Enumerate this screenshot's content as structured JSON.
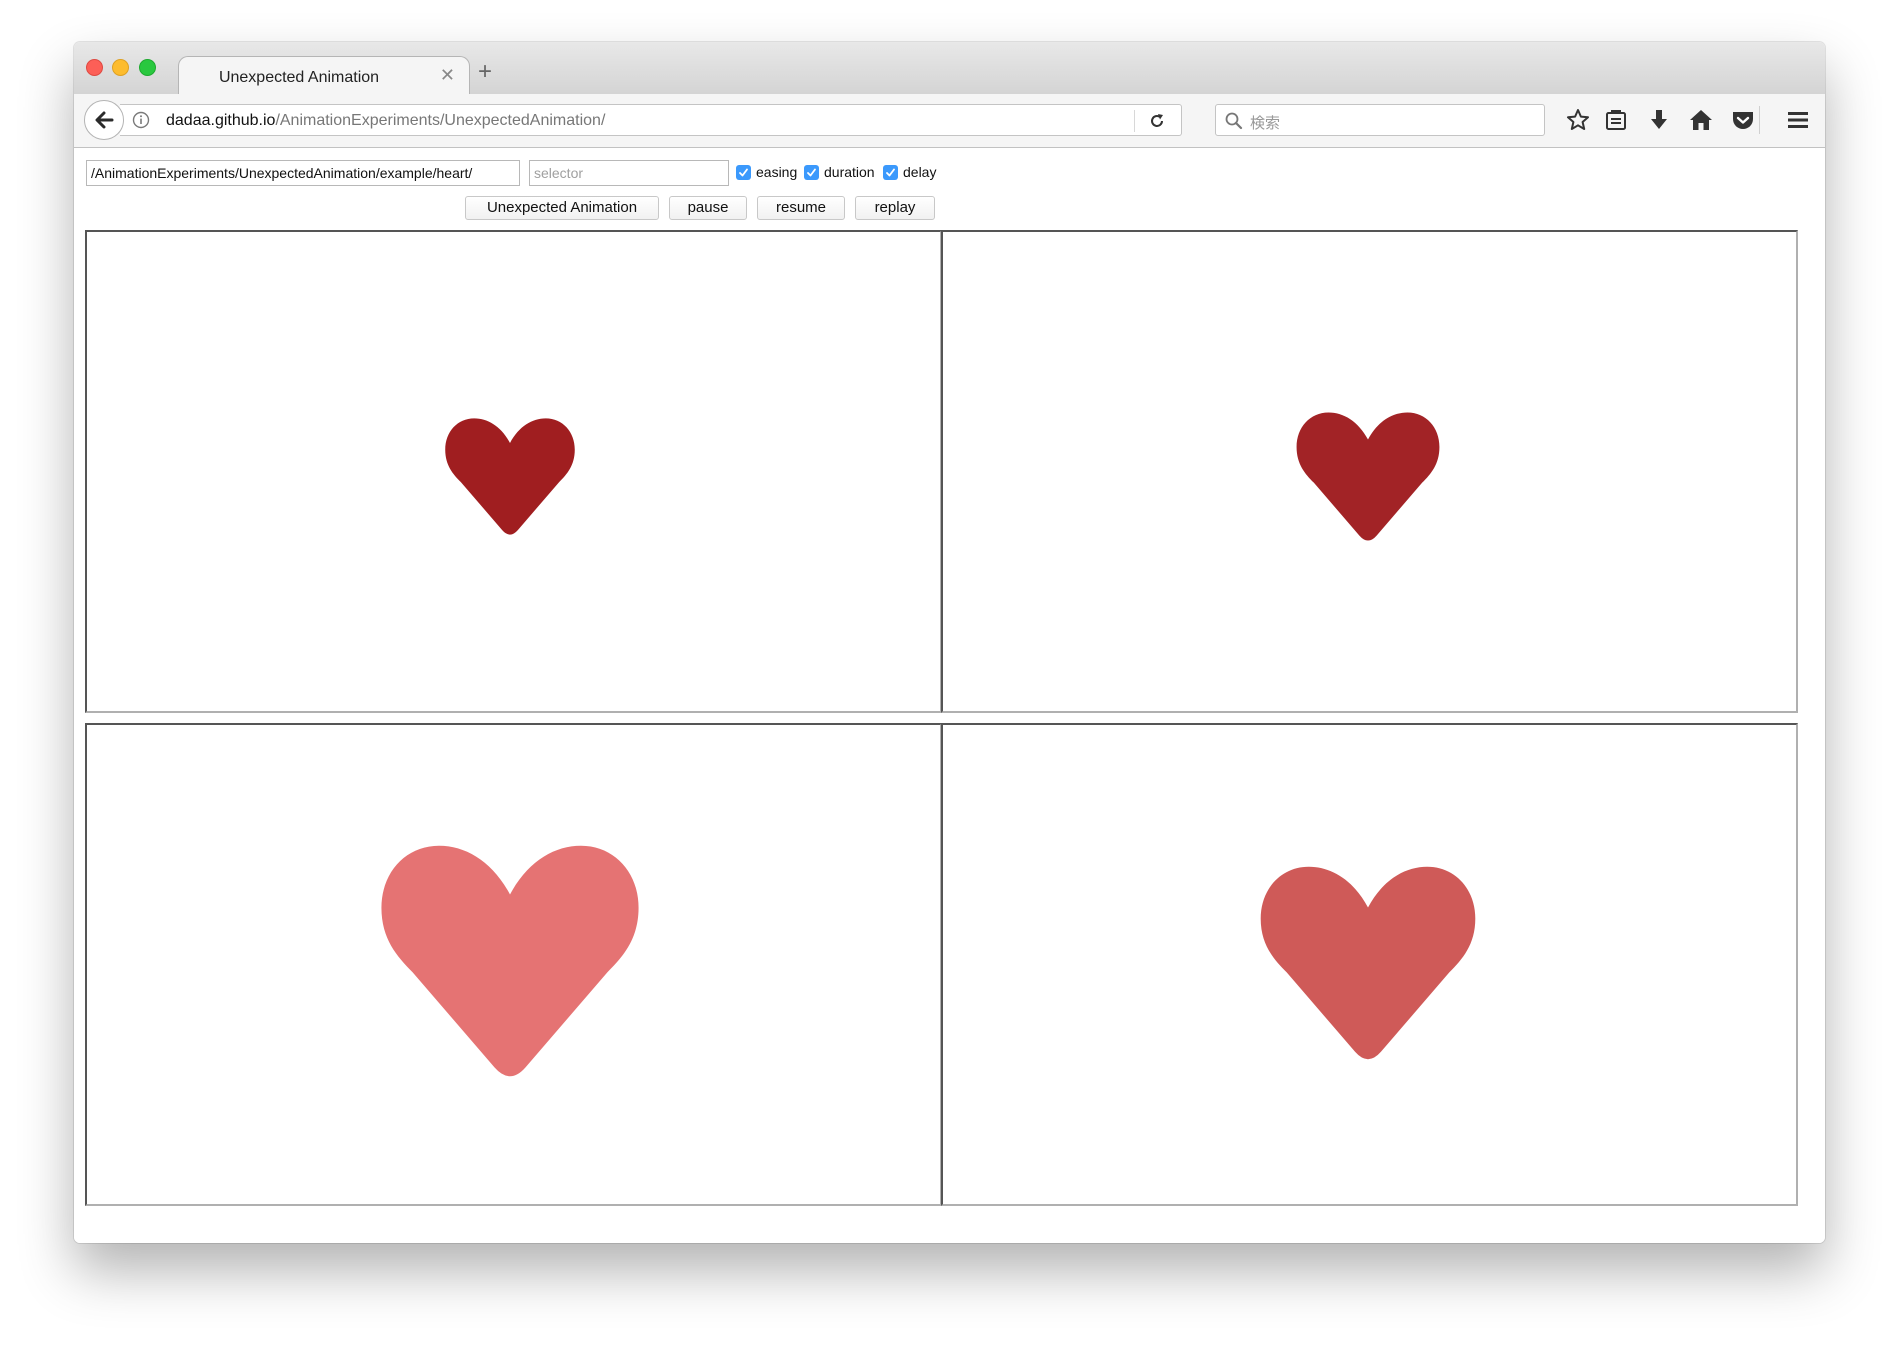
{
  "browser": {
    "tab_title": "Unexpected Animation",
    "tab_close": "✕",
    "new_tab": "+",
    "url_host": "dadaa.github.io",
    "url_path": "/AnimationExperiments/UnexpectedAnimation/",
    "search_placeholder": "検索",
    "toolbar_icons": [
      "bookmark-star-icon",
      "reading-list-icon",
      "download-icon",
      "home-icon",
      "pocket-icon",
      "menu-icon"
    ]
  },
  "controls": {
    "path_value": "/AnimationExperiments/UnexpectedAnimation/example/heart/",
    "selector_placeholder": "selector",
    "checkboxes": [
      {
        "label": "easing",
        "checked": true
      },
      {
        "label": "duration",
        "checked": true
      },
      {
        "label": "delay",
        "checked": true
      }
    ],
    "buttons": {
      "unexpected": "Unexpected Animation",
      "pause": "pause",
      "resume": "resume",
      "replay": "replay"
    }
  },
  "panels": [
    {
      "heart_color": "#a01e20"
    },
    {
      "heart_color": "#a22326"
    },
    {
      "heart_color": "#e57373"
    },
    {
      "heart_color": "#cf5a58"
    }
  ],
  "colors": {
    "checkbox_accent": "#3b99fc"
  }
}
